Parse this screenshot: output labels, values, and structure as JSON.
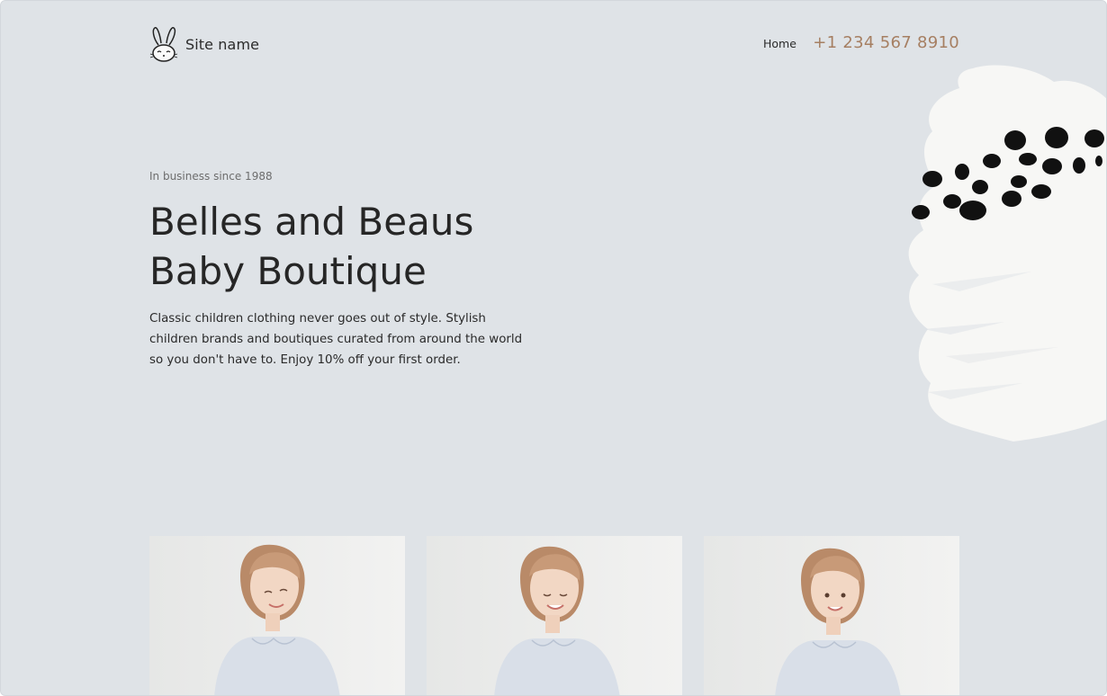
{
  "header": {
    "site_name": "Site name",
    "logo_icon": "bunny-icon",
    "nav": [
      {
        "label": "Home"
      }
    ],
    "phone": "+1 234 567 8910"
  },
  "hero": {
    "eyebrow": "In business since 1988",
    "title_line1": "Belles and Beaus",
    "title_line2": "Baby Boutique",
    "description": "Classic children clothing never goes out of style. Stylish children brands and boutiques curated from around the world so you don't have to. Enjoy 10% off your first order."
  },
  "colors": {
    "background": "#dfe3e7",
    "accent": "#a67f62",
    "text": "#262626"
  },
  "gallery": {
    "photos": [
      {
        "name": "smiling-girl-photo-1"
      },
      {
        "name": "smiling-girl-photo-2"
      },
      {
        "name": "smiling-girl-photo-3"
      }
    ]
  }
}
